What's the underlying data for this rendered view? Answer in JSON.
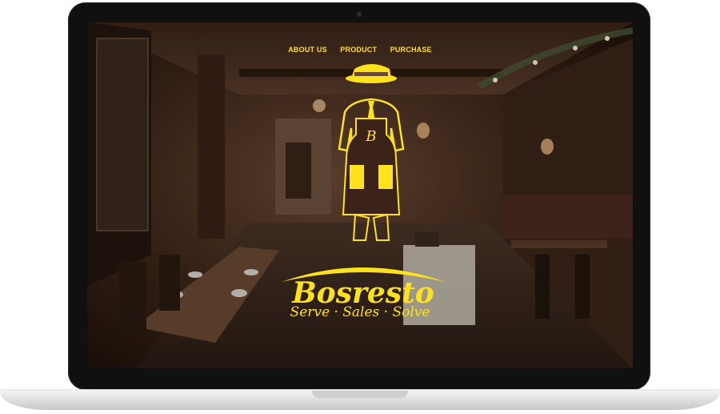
{
  "nav": {
    "items": [
      "ABOUT US",
      "PRODUCT",
      "PURCHASE"
    ]
  },
  "brand": {
    "logo_mark": "B",
    "name": "Bosresto",
    "tagline": "Serve · Sales · Solve",
    "accent_color": "#ffe21b"
  },
  "hero": {
    "image": "restaurant-interior-icon"
  }
}
